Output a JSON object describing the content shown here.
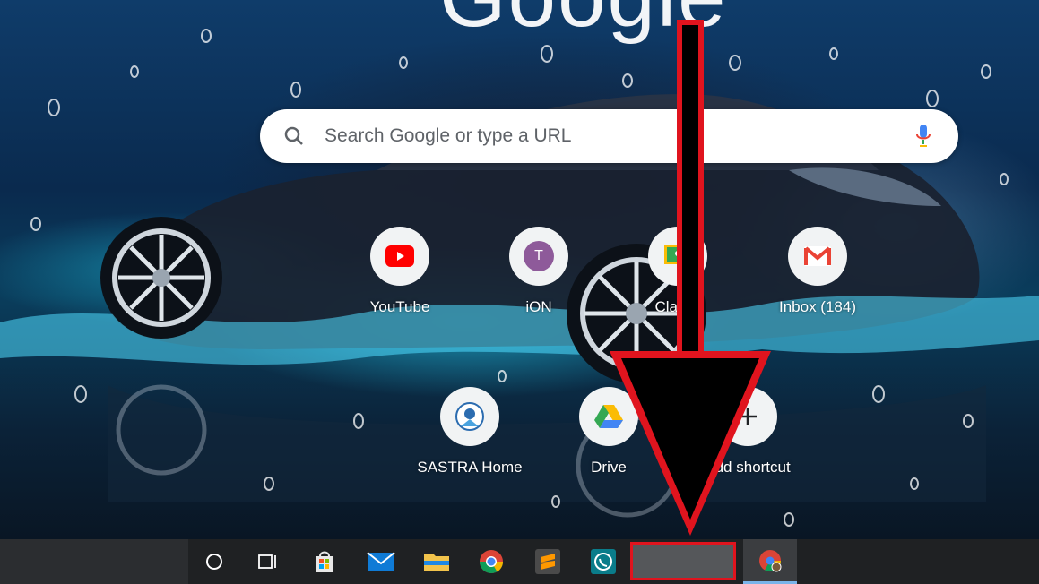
{
  "logo": {
    "text": "Google"
  },
  "search": {
    "placeholder": "Search Google or type a URL"
  },
  "shortcuts": [
    {
      "label": "YouTube",
      "icon": "youtube-icon"
    },
    {
      "label": "iON",
      "icon": "ion-avatar",
      "avatar_letter": "T"
    },
    {
      "label": "Clas…",
      "icon": "classroom-icon"
    },
    {
      "label": "Inbox (184)",
      "icon": "gmail-icon"
    },
    {
      "label": "SASTRA Home",
      "icon": "sastra-icon"
    },
    {
      "label": "Drive",
      "icon": "drive-icon"
    },
    {
      "label": "Add shortcut",
      "icon": "plus-icon"
    }
  ],
  "taskbar": {
    "items": [
      {
        "name": "cortana-search-icon"
      },
      {
        "name": "task-view-icon"
      },
      {
        "name": "microsoft-store-icon"
      },
      {
        "name": "mail-icon"
      },
      {
        "name": "file-explorer-icon"
      },
      {
        "name": "chrome-icon"
      },
      {
        "name": "sublime-text-icon"
      },
      {
        "name": "whatsapp-icon"
      },
      {
        "name": "highlighted-empty-slot"
      },
      {
        "name": "chrome-profile-icon"
      }
    ]
  },
  "colors": {
    "annotation_red": "#e0141e",
    "taskbar_bg": "#1f2123",
    "active_underline": "#7ab4ea"
  }
}
